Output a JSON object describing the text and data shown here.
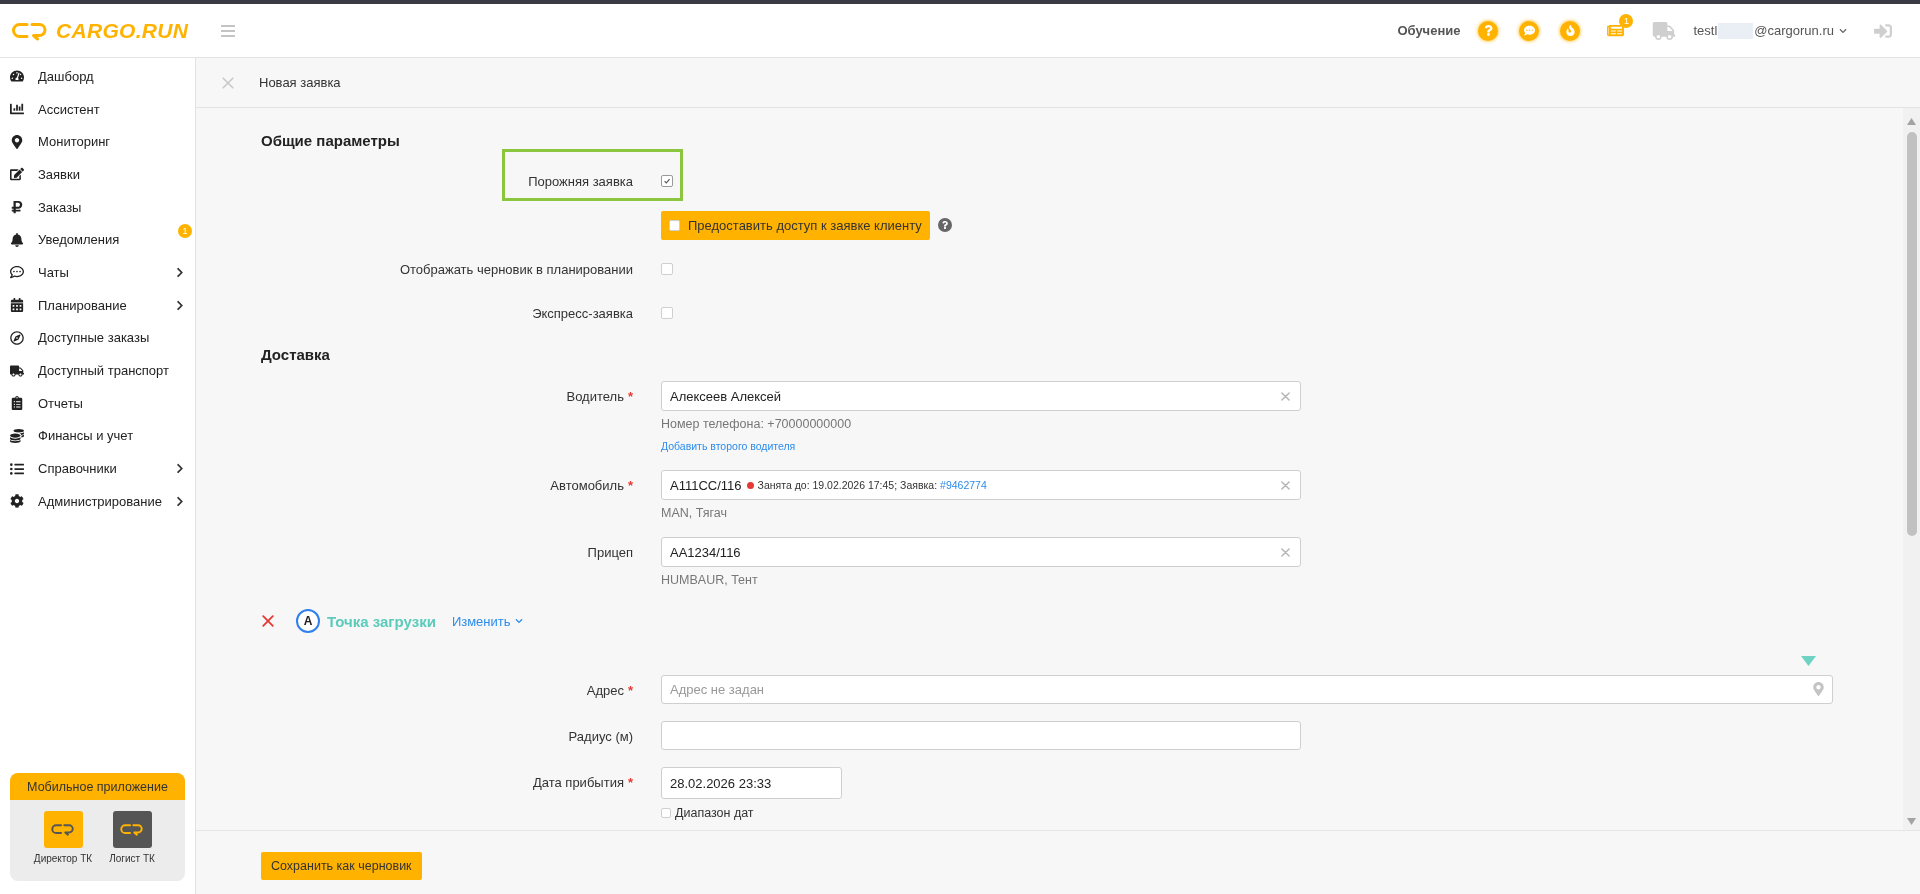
{
  "header": {
    "logo": "CARGO.RUN",
    "training_label": "Обучение",
    "news_badge": "1",
    "user": {
      "email_start": "testl",
      "email_end": "@cargorun.ru"
    }
  },
  "sidebar": {
    "items": [
      {
        "label": "Дашборд",
        "has_submenu": false
      },
      {
        "label": "Ассистент",
        "has_submenu": false
      },
      {
        "label": "Мониторинг",
        "has_submenu": false
      },
      {
        "label": "Заявки",
        "has_submenu": false
      },
      {
        "label": "Заказы",
        "has_submenu": false
      },
      {
        "label": "Уведомления",
        "has_submenu": false,
        "badge": "1"
      },
      {
        "label": "Чаты",
        "has_submenu": true
      },
      {
        "label": "Планирование",
        "has_submenu": true
      },
      {
        "label": "Доступные заказы",
        "has_submenu": false
      },
      {
        "label": "Доступный транспорт",
        "has_submenu": false
      },
      {
        "label": "Отчеты",
        "has_submenu": false
      },
      {
        "label": "Финансы и учет",
        "has_submenu": false
      },
      {
        "label": "Справочники",
        "has_submenu": true
      },
      {
        "label": "Администрирование",
        "has_submenu": true
      }
    ],
    "mobile_app": {
      "title": "Мобильное приложение",
      "apps": [
        {
          "label": "Директор ТК",
          "kind": "director"
        },
        {
          "label": "Логист ТК",
          "kind": "logist"
        }
      ]
    }
  },
  "page": {
    "title": "Новая заявка"
  },
  "form": {
    "general": {
      "title": "Общие параметры",
      "fields": [
        {
          "kind": "checkbox",
          "label": "Порожняя заявка",
          "checked": true,
          "highlighted": true
        },
        {
          "kind": "access_button",
          "label": "Предоставить доступ к заявке клиенту",
          "checked": false
        },
        {
          "kind": "checkbox",
          "label": "Отображать черновик в планировании",
          "checked": false,
          "highlighted": false
        },
        {
          "kind": "checkbox",
          "label": "Экспресс-заявка",
          "checked": false,
          "highlighted": false
        }
      ]
    },
    "delivery": {
      "title": "Доставка",
      "fields": [
        {
          "label": "Водитель",
          "required_mark": "*",
          "value": "Алексеев Алексей",
          "notes": [
            {
              "kind": "text",
              "text": "Номер телефона: +70000000000"
            },
            {
              "kind": "link",
              "text": "Добавить второго водителя"
            }
          ]
        },
        {
          "label": "Автомобиль",
          "required_mark": "*",
          "value": "А111СС/116",
          "status": {
            "color": "#e53935",
            "text": "Занята до: 19.02.2026 17:45; Заявка:",
            "link": "#9462774"
          },
          "notes": [
            {
              "kind": "text",
              "text": "MAN, Тягач"
            }
          ]
        },
        {
          "label": "Прицеп",
          "value": "АА1234/116",
          "notes": [
            {
              "kind": "text",
              "text": "HUMBAUR, Тент"
            }
          ]
        }
      ]
    },
    "point": {
      "marker": "A",
      "title": "Точка загрузки",
      "change_link": "Изменить",
      "fields": [
        {
          "kind": "address",
          "label": "Адрес",
          "required_mark": "*",
          "placeholder": "Адрес не задан"
        },
        {
          "kind": "number",
          "label": "Радиус (м)"
        },
        {
          "kind": "date",
          "label": "Дата прибытия",
          "required_mark": "*",
          "value": "28.02.2026 23:33",
          "range": {
            "label": "Диапазон дат",
            "checked": false
          }
        }
      ]
    }
  },
  "footer": {
    "save_draft_button": "Сохранить как черновик"
  }
}
